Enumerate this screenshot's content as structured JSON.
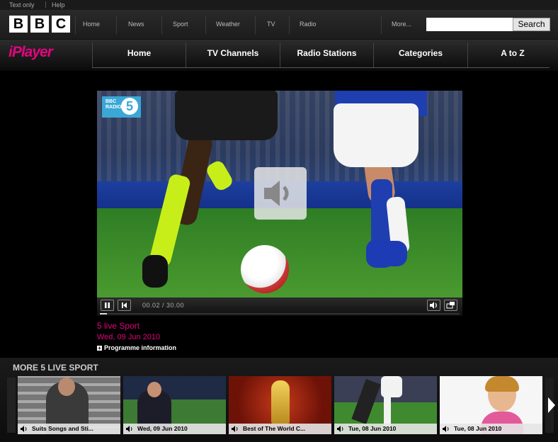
{
  "utility": {
    "text_only": "Text only",
    "help": "Help"
  },
  "masthead": {
    "logo": [
      "B",
      "B",
      "C"
    ],
    "nav": [
      "Home",
      "News",
      "Sport",
      "Weather",
      "TV",
      "Radio",
      "More..."
    ],
    "search_placeholder": "",
    "search_button": "Search"
  },
  "iplayer": {
    "logo": "iPlayer",
    "tabs": [
      "Home",
      "TV Channels",
      "Radio Stations",
      "Categories",
      "A to Z"
    ]
  },
  "player": {
    "station_badge": {
      "bbc": "BBC RADIO",
      "number": "5"
    },
    "timecode": "00.02 / 30.00",
    "progress": 0.007
  },
  "programme": {
    "title": "5 live Sport",
    "date": "Wed, 09 Jun 2010",
    "info_link": "Programme information"
  },
  "more": {
    "heading": "MORE 5 LIVE SPORT",
    "tiles": [
      {
        "caption": "Suits Songs and Sti..."
      },
      {
        "caption": "Wed, 09 Jun 2010"
      },
      {
        "caption": "Best of The World C..."
      },
      {
        "caption": "Tue, 08 Jun 2010"
      },
      {
        "caption": "Tue, 08 Jun 2010"
      }
    ]
  },
  "colors": {
    "brand_pink": "#e0067e",
    "background": "#000000",
    "badge_blue": "#3aa7d5"
  },
  "icons": [
    "speaker-icon",
    "pause-icon",
    "skip-back-icon",
    "volume-icon",
    "fullscreen-icon",
    "plus-icon",
    "chevron-right-icon"
  ]
}
